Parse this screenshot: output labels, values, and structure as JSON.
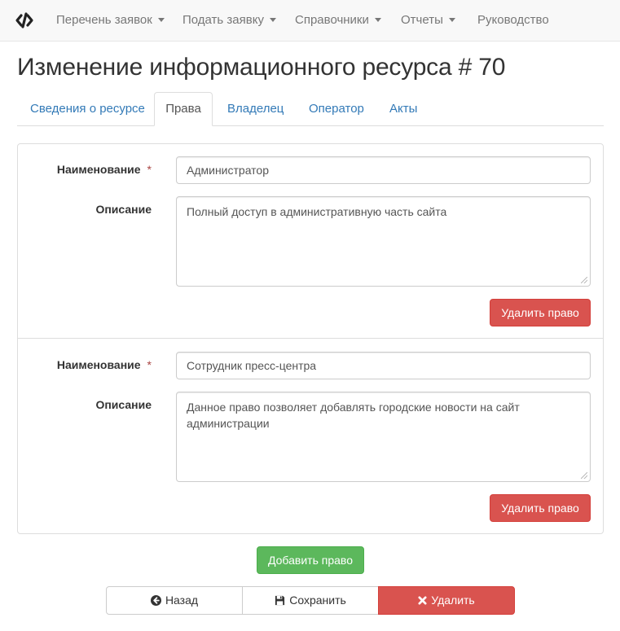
{
  "navbar": {
    "brand_icon": "code-brand-icon",
    "items": [
      {
        "label": "Перечень заявок",
        "dropdown": true
      },
      {
        "label": "Подать заявку",
        "dropdown": true
      },
      {
        "label": "Справочники",
        "dropdown": true
      },
      {
        "label": "Отчеты",
        "dropdown": true
      },
      {
        "label": "Руководство",
        "dropdown": false
      }
    ]
  },
  "page": {
    "title": "Изменение информационного ресурса # 70"
  },
  "tabs": [
    {
      "label": "Сведения о ресурсе",
      "active": false
    },
    {
      "label": "Права",
      "active": true
    },
    {
      "label": "Владелец",
      "active": false
    },
    {
      "label": "Оператор",
      "active": false
    },
    {
      "label": "Акты",
      "active": false
    }
  ],
  "rights": [
    {
      "name_label": "Наименование",
      "required_mark": "*",
      "name_value": "Администратор",
      "description_label": "Описание",
      "description_value": "Полный доступ в административную часть сайта",
      "delete_label": "Удалить право"
    },
    {
      "name_label": "Наименование",
      "required_mark": "*",
      "name_value": "Сотрудник пресс-центра",
      "description_label": "Описание",
      "description_value": "Данное право позволяет добавлять городские новости на сайт администрации",
      "delete_label": "Удалить право"
    }
  ],
  "actions": {
    "add_right_label": "Добавить право",
    "back_label": "Назад",
    "save_label": "Сохранить",
    "delete_label": "Удалить"
  },
  "colors": {
    "link": "#337ab7",
    "danger": "#d9534f",
    "success": "#5cb85c",
    "required": "#a94442"
  }
}
